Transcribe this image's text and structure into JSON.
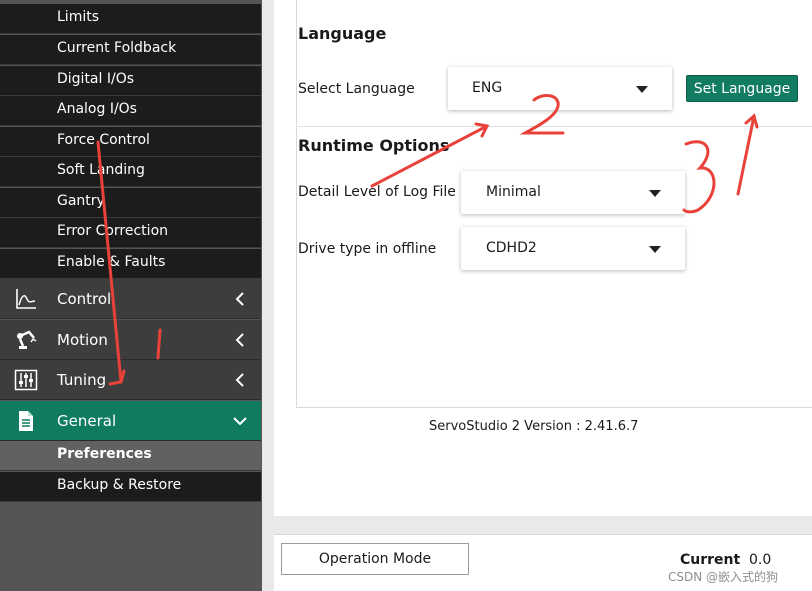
{
  "sidebar": {
    "subitems_top": [
      {
        "label": "Limits"
      },
      {
        "label": "Current Foldback"
      },
      {
        "label": "Digital I/Os"
      },
      {
        "label": "Analog I/Os"
      },
      {
        "label": "Force Control"
      },
      {
        "label": "Soft Landing"
      },
      {
        "label": "Gantry"
      },
      {
        "label": "Error Correction"
      },
      {
        "label": "Enable & Faults"
      }
    ],
    "nav": [
      {
        "label": "Control",
        "icon": "chart-icon"
      },
      {
        "label": "Motion",
        "icon": "robot-arm-icon"
      },
      {
        "label": "Tuning",
        "icon": "sliders-icon"
      },
      {
        "label": "General",
        "icon": "document-icon"
      }
    ],
    "general_subitems": [
      {
        "label": "Preferences"
      },
      {
        "label": "Backup & Restore"
      }
    ]
  },
  "main": {
    "language_section": {
      "title": "Language",
      "select_label": "Select Language",
      "selected_value": "ENG",
      "button_label": "Set Language"
    },
    "runtime_section": {
      "title": "Runtime Options",
      "log_label": "Detail Level of Log File",
      "log_value": "Minimal",
      "drive_label": "Drive type in offline",
      "drive_value": "CDHD2"
    },
    "version": "ServoStudio 2 Version : 2.41.6.7"
  },
  "bottom_bar": {
    "operation_mode_label": "Operation Mode",
    "current_label": "Current",
    "current_value": "0.0",
    "watermark": "CSDN @嵌入式的狗"
  },
  "colors": {
    "accent": "#0f7b61",
    "annotation": "#e8423a",
    "sidebar_dark": "#1c1c1c",
    "sidebar_nav": "#3d3d3d"
  }
}
